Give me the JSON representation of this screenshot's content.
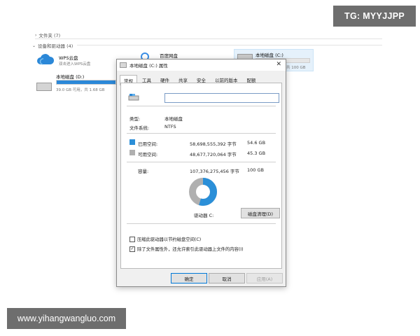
{
  "watermarks": {
    "top": "TG: MYYJJPP",
    "bottom": "www.yihangwangluo.com"
  },
  "explorer": {
    "folders_label": "文件夹 (7)",
    "devices_label": "设备和驱动器 (4)",
    "drives": [
      {
        "name": "WPS云盘",
        "sub": "双击进入WPS云盘",
        "icon": "cloud-icon"
      },
      {
        "name": "百度网盘",
        "sub": "",
        "icon": "baidu-netdisk-icon"
      },
      {
        "name": "本地磁盘 (C:)",
        "sub": "共 100 GB",
        "icon": "drive-icon",
        "used_fraction": 0.55
      },
      {
        "name": "本地磁盘 (D:)",
        "sub": "39.0 GB 可用，共 1.68 GB",
        "icon": "drive-icon",
        "used_fraction": 0.95
      }
    ]
  },
  "dialog": {
    "title": "本地磁盘 (C:) 属性",
    "close": "✕",
    "tabs": [
      "常规",
      "工具",
      "硬件",
      "共享",
      "安全",
      "以前的版本",
      "配额"
    ],
    "active_tab": 0,
    "type_label": "类型:",
    "type_value": "本地磁盘",
    "fs_label": "文件系统:",
    "fs_value": "NTFS",
    "used_label": "已用空间:",
    "used_bytes": "58,698,555,392 字节",
    "used_gb": "54.6 GB",
    "free_label": "可用空间:",
    "free_bytes": "48,677,720,064 字节",
    "free_gb": "45.3 GB",
    "capacity_label": "容量:",
    "capacity_bytes": "107,376,275,456 字节",
    "capacity_gb": "100 GB",
    "drive_label": "驱动器 C:",
    "cleanup_button": "磁盘清理(D)",
    "compress_label": "压缩此驱动器以节约磁盘空间(C)",
    "compress_checked": false,
    "index_label": "除了文件属性外，还允许索引此驱动器上文件的内容(I)",
    "index_checked": true,
    "ok_button": "确定",
    "cancel_button": "取消",
    "apply_button": "应用(A)",
    "used_fraction": 0.547,
    "colors": {
      "used": "#2b8fd8",
      "free": "#b0b0b0",
      "accent": "#0078d7"
    }
  }
}
